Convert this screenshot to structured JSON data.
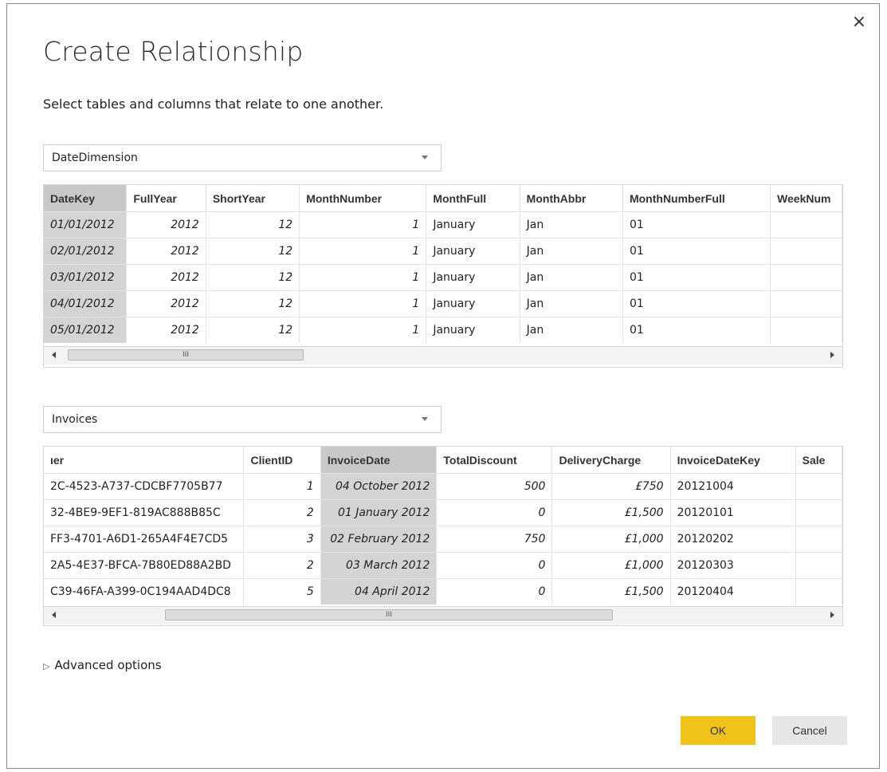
{
  "dialog": {
    "title": "Create Relationship",
    "subtitle": "Select tables and columns that relate to one another.",
    "close_glyph": "×"
  },
  "table1": {
    "selected_table": "DateDimension",
    "columns": [
      "DateKey",
      "FullYear",
      "ShortYear",
      "MonthNumber",
      "MonthFull",
      "MonthAbbr",
      "MonthNumberFull",
      "WeekNum"
    ],
    "selected_column": "DateKey",
    "rows": [
      [
        "01/01/2012",
        "2012",
        "12",
        "1",
        "January",
        "Jan",
        "01",
        ""
      ],
      [
        "02/01/2012",
        "2012",
        "12",
        "1",
        "January",
        "Jan",
        "01",
        ""
      ],
      [
        "03/01/2012",
        "2012",
        "12",
        "1",
        "January",
        "Jan",
        "01",
        ""
      ],
      [
        "04/01/2012",
        "2012",
        "12",
        "1",
        "January",
        "Jan",
        "01",
        ""
      ],
      [
        "05/01/2012",
        "2012",
        "12",
        "1",
        "January",
        "Jan",
        "01",
        ""
      ]
    ]
  },
  "table2": {
    "selected_table": "Invoices",
    "columns": [
      "ıer",
      "ClientID",
      "InvoiceDate",
      "TotalDiscount",
      "DeliveryCharge",
      "InvoiceDateKey",
      "Sale"
    ],
    "selected_column": "InvoiceDate",
    "rows": [
      [
        "2C-4523-A737-CDCBF7705B77",
        "1",
        "04 October 2012",
        "500",
        "£750",
        "20121004",
        ""
      ],
      [
        "32-4BE9-9EF1-819AC888B85C",
        "2",
        "01 January 2012",
        "0",
        "£1,500",
        "20120101",
        ""
      ],
      [
        "FF3-4701-A6D1-265A4F4E7CD5",
        "3",
        "02 February 2012",
        "750",
        "£1,000",
        "20120202",
        ""
      ],
      [
        "2A5-4E37-BFCA-7B80ED88A2BD",
        "2",
        "03 March 2012",
        "0",
        "£1,000",
        "20120303",
        ""
      ],
      [
        "C39-46FA-A399-0C194AAD4DC8",
        "5",
        "04 April 2012",
        "0",
        "£1,500",
        "20120404",
        ""
      ]
    ]
  },
  "scrollbar_grip": "III",
  "advanced_options": "Advanced options",
  "buttons": {
    "ok": "OK",
    "cancel": "Cancel"
  },
  "colors": {
    "ok_button": "#f1c318",
    "selected_column": "#c8c8c8"
  }
}
